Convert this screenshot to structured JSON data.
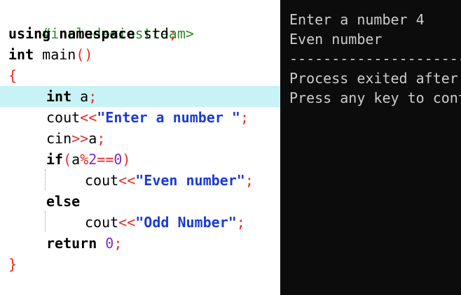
{
  "editor": {
    "include_directive": "#include<iostream>",
    "using_kw": "using",
    "namespace_kw": "namespace",
    "std_name": "std",
    "semicolon": ";",
    "int_kw": "int",
    "main_name": "main",
    "parens": "()",
    "open_brace": "{",
    "var_a": "a",
    "cout_name": "cout",
    "stream_out": "<<",
    "prompt_string": "\"Enter a number \"",
    "cin_name": "cin",
    "stream_in": ">>",
    "if_kw": "if",
    "open_paren": "(",
    "close_paren": ")",
    "mod_op": "%",
    "two": "2",
    "eq_op": "==",
    "zero": "0",
    "even_string": "\"Even number\"",
    "else_kw": "else",
    "odd_string": "\"Odd Number\"",
    "return_kw": "return",
    "close_brace": "}"
  },
  "terminal": {
    "line1": "Enter a number 4",
    "line2": "Even number",
    "separator": "--------------------------------",
    "line4": "Process exited after",
    "line5": "Press any key to continue"
  },
  "colors": {
    "keyword": "#000000",
    "preprocessor": "#2e8b2e",
    "symbol": "#e8281f",
    "number": "#7b2bd1",
    "string": "#1b3bd6",
    "highlight": "#c8f3f6",
    "terminal_bg": "#0c0c0c",
    "terminal_text": "#cccccc"
  }
}
